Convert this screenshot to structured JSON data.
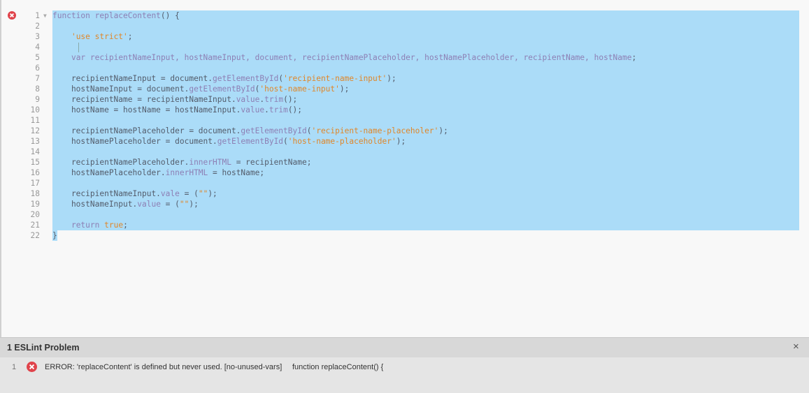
{
  "editor": {
    "lines": [
      {
        "num": "1",
        "fold": true,
        "tokens": [
          {
            "t": "function ",
            "c": "kw"
          },
          {
            "t": "replaceContent",
            "c": "fn"
          },
          {
            "t": "() {",
            "c": "plain"
          }
        ]
      },
      {
        "num": "2",
        "tokens": []
      },
      {
        "num": "3",
        "tokens": [
          {
            "t": "    ",
            "c": "plain"
          },
          {
            "t": "'use strict'",
            "c": "str"
          },
          {
            "t": ";",
            "c": "plain"
          }
        ]
      },
      {
        "num": "4",
        "tokens": []
      },
      {
        "num": "5",
        "tokens": [
          {
            "t": "    ",
            "c": "plain"
          },
          {
            "t": "var ",
            "c": "kw"
          },
          {
            "t": "recipientNameInput, hostNameInput, document, recipientNamePlaceholder, hostNamePlaceholder, recipientName, hostName",
            "c": "fn"
          },
          {
            "t": ";",
            "c": "plain"
          }
        ]
      },
      {
        "num": "6",
        "tokens": []
      },
      {
        "num": "7",
        "tokens": [
          {
            "t": "    recipientNameInput = document.",
            "c": "plain"
          },
          {
            "t": "getElementById",
            "c": "prop"
          },
          {
            "t": "(",
            "c": "plain"
          },
          {
            "t": "'recipient-name-input'",
            "c": "str"
          },
          {
            "t": ");",
            "c": "plain"
          }
        ]
      },
      {
        "num": "8",
        "tokens": [
          {
            "t": "    hostNameInput = document.",
            "c": "plain"
          },
          {
            "t": "getElementById",
            "c": "prop"
          },
          {
            "t": "(",
            "c": "plain"
          },
          {
            "t": "'host-name-input'",
            "c": "str"
          },
          {
            "t": ");",
            "c": "plain"
          }
        ]
      },
      {
        "num": "9",
        "tokens": [
          {
            "t": "    recipientName = recipientNameInput.",
            "c": "plain"
          },
          {
            "t": "value",
            "c": "prop"
          },
          {
            "t": ".",
            "c": "plain"
          },
          {
            "t": "trim",
            "c": "prop"
          },
          {
            "t": "();",
            "c": "plain"
          }
        ]
      },
      {
        "num": "10",
        "tokens": [
          {
            "t": "    hostName = hostName = hostNameInput.",
            "c": "plain"
          },
          {
            "t": "value",
            "c": "prop"
          },
          {
            "t": ".",
            "c": "plain"
          },
          {
            "t": "trim",
            "c": "prop"
          },
          {
            "t": "();",
            "c": "plain"
          }
        ]
      },
      {
        "num": "11",
        "tokens": []
      },
      {
        "num": "12",
        "tokens": [
          {
            "t": "    recipientNamePlaceholder = document.",
            "c": "plain"
          },
          {
            "t": "getElementById",
            "c": "prop"
          },
          {
            "t": "(",
            "c": "plain"
          },
          {
            "t": "'recipient-name-placeholer'",
            "c": "str"
          },
          {
            "t": ");",
            "c": "plain"
          }
        ]
      },
      {
        "num": "13",
        "tokens": [
          {
            "t": "    hostNamePlaceholder = document.",
            "c": "plain"
          },
          {
            "t": "getElementById",
            "c": "prop"
          },
          {
            "t": "(",
            "c": "plain"
          },
          {
            "t": "'host-name-placeholder'",
            "c": "str"
          },
          {
            "t": ");",
            "c": "plain"
          }
        ]
      },
      {
        "num": "14",
        "tokens": []
      },
      {
        "num": "15",
        "tokens": [
          {
            "t": "    recipientNamePlaceholder.",
            "c": "plain"
          },
          {
            "t": "innerHTML",
            "c": "prop"
          },
          {
            "t": " = recipientName;",
            "c": "plain"
          }
        ]
      },
      {
        "num": "16",
        "tokens": [
          {
            "t": "    hostNamePlaceholder.",
            "c": "plain"
          },
          {
            "t": "innerHTML",
            "c": "prop"
          },
          {
            "t": " = hostName;",
            "c": "plain"
          }
        ]
      },
      {
        "num": "17",
        "tokens": []
      },
      {
        "num": "18",
        "tokens": [
          {
            "t": "    recipientNameInput.",
            "c": "plain"
          },
          {
            "t": "vale",
            "c": "prop"
          },
          {
            "t": " = (",
            "c": "plain"
          },
          {
            "t": "\"\"",
            "c": "str"
          },
          {
            "t": ");",
            "c": "plain"
          }
        ]
      },
      {
        "num": "19",
        "tokens": [
          {
            "t": "    hostNameInput.",
            "c": "plain"
          },
          {
            "t": "value",
            "c": "prop"
          },
          {
            "t": " = (",
            "c": "plain"
          },
          {
            "t": "\"\"",
            "c": "str"
          },
          {
            "t": ");",
            "c": "plain"
          }
        ]
      },
      {
        "num": "20",
        "tokens": []
      },
      {
        "num": "21",
        "tokens": [
          {
            "t": "    ",
            "c": "plain"
          },
          {
            "t": "return ",
            "c": "kw"
          },
          {
            "t": "true",
            "c": "lit"
          },
          {
            "t": ";",
            "c": "plain"
          }
        ]
      },
      {
        "num": "22",
        "tokens": [
          {
            "t": "}",
            "c": "plain"
          }
        ]
      }
    ]
  },
  "problems_panel": {
    "title": "1 ESLint Problem",
    "close_glyph": "×",
    "rows": [
      {
        "num": "1",
        "message": "ERROR: 'replaceContent' is defined but never used. [no-unused-vars]",
        "code": "function replaceContent() {"
      }
    ]
  },
  "colors": {
    "selection": "#abdcf8",
    "error_icon": "#e0434b",
    "keyword": "#8d7fb4",
    "string": "#e0872a"
  },
  "icons": {
    "gutter": "error-icon",
    "fold": "fold-arrow-icon",
    "panel_row": "error-icon"
  }
}
